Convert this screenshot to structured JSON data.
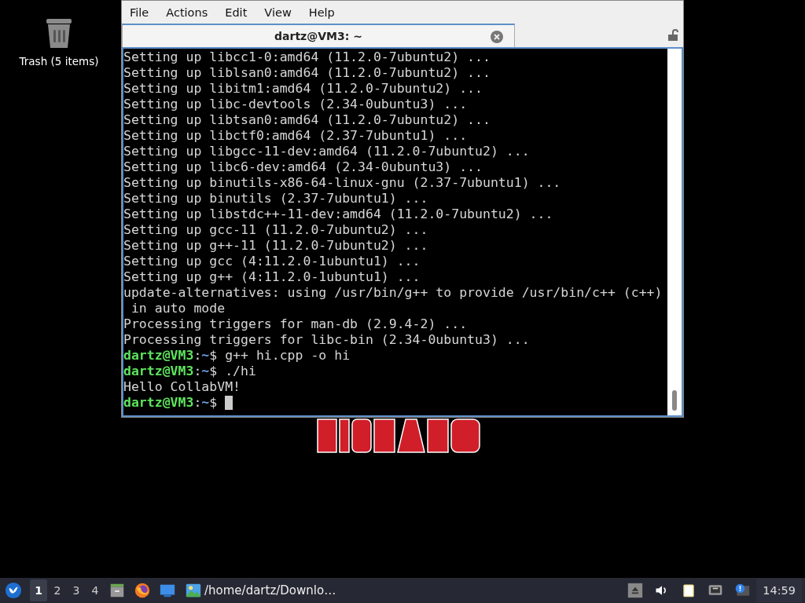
{
  "desktop_icons": [
    {
      "label": "Trash (5 items)",
      "kind": "trash"
    }
  ],
  "terminal": {
    "menu": [
      "File",
      "Actions",
      "Edit",
      "View",
      "Help"
    ],
    "tabs": [
      {
        "title": "dartz@VM3: ~",
        "selected": true
      }
    ],
    "lines": [
      {
        "kind": "output",
        "text": "Setting up libcc1-0:amd64 (11.2.0-7ubuntu2) ..."
      },
      {
        "kind": "output",
        "text": "Setting up liblsan0:amd64 (11.2.0-7ubuntu2) ..."
      },
      {
        "kind": "output",
        "text": "Setting up libitm1:amd64 (11.2.0-7ubuntu2) ..."
      },
      {
        "kind": "output",
        "text": "Setting up libc-devtools (2.34-0ubuntu3) ..."
      },
      {
        "kind": "output",
        "text": "Setting up libtsan0:amd64 (11.2.0-7ubuntu2) ..."
      },
      {
        "kind": "output",
        "text": "Setting up libctf0:amd64 (2.37-7ubuntu1) ..."
      },
      {
        "kind": "output",
        "text": "Setting up libgcc-11-dev:amd64 (11.2.0-7ubuntu2) ..."
      },
      {
        "kind": "output",
        "text": "Setting up libc6-dev:amd64 (2.34-0ubuntu3) ..."
      },
      {
        "kind": "output",
        "text": "Setting up binutils-x86-64-linux-gnu (2.37-7ubuntu1) ..."
      },
      {
        "kind": "output",
        "text": "Setting up binutils (2.37-7ubuntu1) ..."
      },
      {
        "kind": "output",
        "text": "Setting up libstdc++-11-dev:amd64 (11.2.0-7ubuntu2) ..."
      },
      {
        "kind": "output",
        "text": "Setting up gcc-11 (11.2.0-7ubuntu2) ..."
      },
      {
        "kind": "output",
        "text": "Setting up g++-11 (11.2.0-7ubuntu2) ..."
      },
      {
        "kind": "output",
        "text": "Setting up gcc (4:11.2.0-1ubuntu1) ..."
      },
      {
        "kind": "output",
        "text": "Setting up g++ (4:11.2.0-1ubuntu1) ..."
      },
      {
        "kind": "output",
        "text": "update-alternatives: using /usr/bin/g++ to provide /usr/bin/c++ (c++)"
      },
      {
        "kind": "output",
        "text": " in auto mode"
      },
      {
        "kind": "output",
        "text": "Processing triggers for man-db (2.9.4-2) ..."
      },
      {
        "kind": "output",
        "text": "Processing triggers for libc-bin (2.34-0ubuntu3) ..."
      },
      {
        "kind": "prompt",
        "user_host": "dartz@VM3",
        "sep": ":",
        "path": "~",
        "symbol": "$",
        "command": "g++ hi.cpp -o hi"
      },
      {
        "kind": "prompt",
        "user_host": "dartz@VM3",
        "sep": ":",
        "path": "~",
        "symbol": "$",
        "command": "./hi"
      },
      {
        "kind": "output",
        "text": "Hello CollabVM!"
      },
      {
        "kind": "prompt",
        "user_host": "dartz@VM3",
        "sep": ":",
        "path": "~",
        "symbol": "$",
        "cursor": true
      }
    ]
  },
  "taskbar": {
    "workspaces": [
      {
        "label": "1",
        "selected": true
      },
      {
        "label": "2",
        "selected": false
      },
      {
        "label": "3",
        "selected": false
      },
      {
        "label": "4",
        "selected": false
      }
    ],
    "launchers": [
      {
        "kind": "files"
      },
      {
        "kind": "browser"
      },
      {
        "kind": "desktop"
      }
    ],
    "tasks": [
      {
        "title": "/home/dartz/Downlo…"
      }
    ],
    "tray": [
      {
        "kind": "eject"
      },
      {
        "kind": "volume"
      },
      {
        "kind": "clipboard"
      },
      {
        "kind": "network"
      },
      {
        "kind": "notify"
      }
    ],
    "clock": "14:59"
  }
}
